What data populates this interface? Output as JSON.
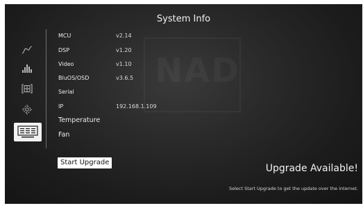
{
  "header": {
    "title": "System Info"
  },
  "watermark": {
    "logo_text": "NAD"
  },
  "sidebar": {
    "items": [
      {
        "icon": "waveform-icon",
        "selected": false
      },
      {
        "icon": "equalizer-icon",
        "selected": false
      },
      {
        "icon": "speaker-grid-icon",
        "selected": false
      },
      {
        "icon": "gear-icon",
        "selected": false
      },
      {
        "icon": "system-info-icon",
        "selected": true
      }
    ]
  },
  "info": {
    "rows": [
      {
        "label": "MCU",
        "value": "v2.14"
      },
      {
        "label": "DSP",
        "value": "v1.20"
      },
      {
        "label": "Video",
        "value": "v1.10"
      },
      {
        "label": "BluOS/OSD",
        "value": "v3.6.5"
      },
      {
        "label": "Serial",
        "value": ""
      },
      {
        "label": "IP",
        "value": "192.168.1.109"
      },
      {
        "label": "Temperature",
        "value": ""
      },
      {
        "label": "Fan",
        "value": ""
      }
    ]
  },
  "actions": {
    "start_upgrade_label": "Start Upgrade"
  },
  "status": {
    "upgrade_available": "Upgrade Available!",
    "upgrade_hint": "Select Start Upgrade to get the update over the internet."
  }
}
